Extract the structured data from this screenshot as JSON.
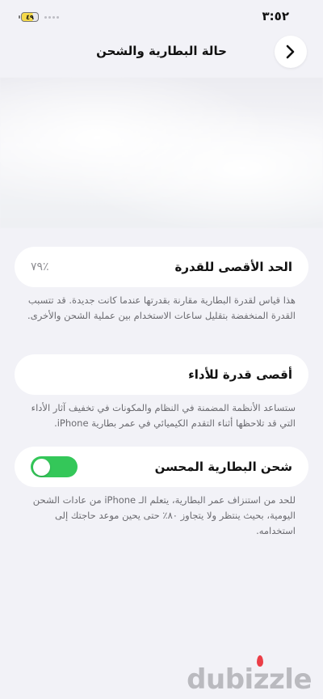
{
  "status_bar": {
    "time": "٣:٥٢",
    "battery_level": "٤٩"
  },
  "nav": {
    "title": "حالة البطارية والشحن"
  },
  "max_capacity": {
    "label": "الحد الأقصى للقدرة",
    "value": "٧٩٪",
    "description": "هذا قياس لقدرة البطارية مقارنة بقدرتها عندما كانت جديدة. قد تتسبب القدرة المنخفضة بتقليل ساعات الاستخدام بين عملية الشحن والأخرى."
  },
  "peak_performance": {
    "label": "أقصى قدرة للأداء",
    "description": "ستساعد الأنظمة المضمنة في النظام والمكونات في تخفيف آثار الأداء التي قد تلاحظها أثناء التقدم الكيميائي في عمر بطارية iPhone."
  },
  "optimized_charging": {
    "label": "شحن البطارية المحسن",
    "enabled": true,
    "description": "للحد من استنزاف عمر البطارية، يتعلم الـ iPhone من عادات الشحن اليومية، بحيث ينتظر ولا يتجاوز ٨٠٪ حتى يحين موعد حاجتك إلى استخدامه."
  },
  "colors": {
    "toggle_on": "#34c759",
    "background": "#f2f2f7"
  },
  "watermark": {
    "text": "dubizzle"
  }
}
